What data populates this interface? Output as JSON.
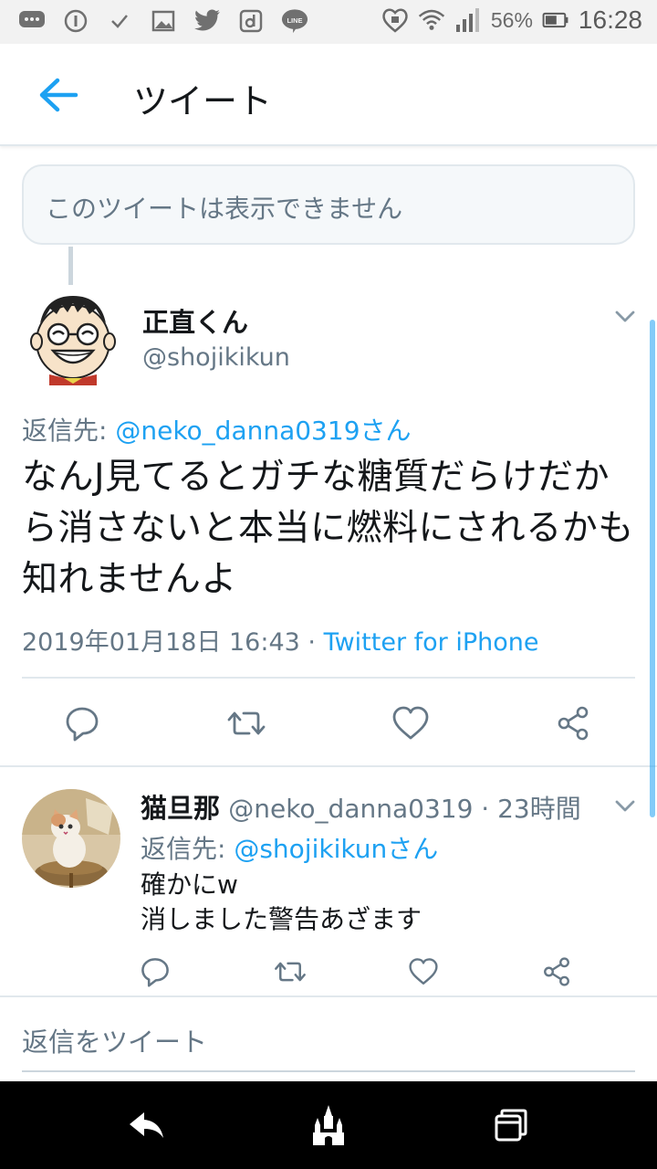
{
  "status_bar": {
    "battery_percent": "56%",
    "time": "16:28",
    "left_icons": [
      "chat-bubble-icon",
      "info-circle-icon",
      "check-icon",
      "image-icon",
      "twitter-bird-icon",
      "d-app-icon",
      "line-app-icon"
    ],
    "right_icons": [
      "heart-lock-icon",
      "wifi-icon",
      "signal-icon",
      "battery-icon"
    ]
  },
  "header": {
    "title": "ツイート"
  },
  "unavailable_tweet": {
    "text": "このツイートは表示できません"
  },
  "main_tweet": {
    "name": "正直くん",
    "handle": "@shojikikun",
    "reply_prefix": "返信先: ",
    "reply_to": "@neko_danna0319さん",
    "body": "なんJ見てるとガチな糖質だらけだから消さないと本当に燃料にされるかも知れませんよ",
    "timestamp": "2019年01月18日 16:43",
    "separator": " · ",
    "source": "Twitter for iPhone"
  },
  "reply_tweet": {
    "name": "猫旦那",
    "handle": "@neko_danna0319",
    "separator": " · ",
    "time_ago": "23時間",
    "reply_prefix": "返信先: ",
    "reply_to": "@shojikikunさん",
    "body": "確かにw\n消しました警告あざます"
  },
  "compose": {
    "placeholder": "返信をツイート"
  },
  "colors": {
    "accent": "#1da1f2",
    "secondary_text": "#657786",
    "primary_text": "#14171a",
    "divider": "#e1e8ed"
  }
}
